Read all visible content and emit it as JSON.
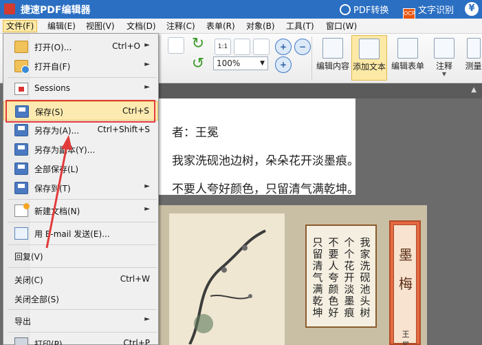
{
  "titlebar": {
    "app_title": "捷速PDF编辑器",
    "pdf_convert": "PDF转换",
    "ocr_badge": "OCR",
    "ocr_label": "文字识别",
    "yen": "¥"
  },
  "menubar": {
    "items": [
      "文件(F)",
      "编辑(E)",
      "视图(V)",
      "文档(D)",
      "注释(C)",
      "表单(R)",
      "对象(B)",
      "工具(T)",
      "窗口(W)"
    ]
  },
  "ribbon": {
    "zoom_value": "100%",
    "buttons": {
      "edit_content": "编辑内容",
      "add_text": "添加文本",
      "edit_form": "编辑表单",
      "annotate": "注释",
      "measure": "测量"
    },
    "small_labels": {
      "fit_1to1": "1:1",
      "zoom_in": "+",
      "zoom_out": "−",
      "zoom_add": "+"
    }
  },
  "file_menu": {
    "items": [
      {
        "label": "打开(O)...",
        "shortcut": "Ctrl+O",
        "submenu": true
      },
      {
        "label": "打开自(F)",
        "shortcut": "",
        "submenu": true
      },
      {
        "label": "Sessions",
        "shortcut": "",
        "submenu": true
      },
      {
        "label": "保存(S)",
        "shortcut": "Ctrl+S",
        "submenu": false
      },
      {
        "label": "另存为(A)...",
        "shortcut": "Ctrl+Shift+S",
        "submenu": false
      },
      {
        "label": "另存为副本(Y)...",
        "shortcut": "",
        "submenu": false
      },
      {
        "label": "全部保存(L)",
        "shortcut": "",
        "submenu": false
      },
      {
        "label": "保存到(T)",
        "shortcut": "",
        "submenu": true
      },
      {
        "label": "新建文档(N)",
        "shortcut": "",
        "submenu": true
      },
      {
        "label": "用 E-mail 发送(E)...",
        "shortcut": "",
        "submenu": false
      },
      {
        "label": "回复(V)",
        "shortcut": "",
        "submenu": false
      },
      {
        "label": "关闭(C)",
        "shortcut": "Ctrl+W",
        "submenu": false
      },
      {
        "label": "关闭全部(S)",
        "shortcut": "",
        "submenu": false
      },
      {
        "label": "导出",
        "shortcut": "",
        "submenu": true
      },
      {
        "label": "打印(P)...",
        "shortcut": "Ctrl+P",
        "submenu": false
      }
    ],
    "submenu_arrow": "►"
  },
  "document": {
    "lines": [
      "者：王冕",
      "我家洗砚池边树，朵朵花开淡墨痕。",
      "不要人夸好颜色，只留清气满乾坤。"
    ],
    "poem_columns": [
      "我家洗砚池头树",
      "个个花开淡墨痕",
      "不要人夸颜色好",
      "只留清气满乾坤"
    ],
    "scroll_title": "墨梅",
    "scroll_author": "王冕"
  },
  "colors": {
    "titlebar": "#2b6fc2",
    "highlight": "#fdeab0",
    "annotation_red": "#e23b3b"
  }
}
